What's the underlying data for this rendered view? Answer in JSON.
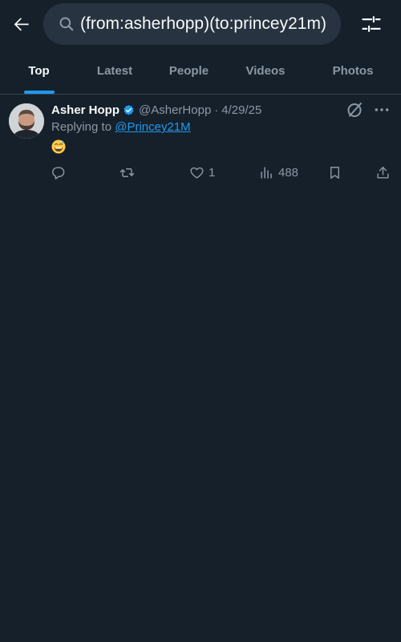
{
  "search": {
    "query": "(from:asherhopp)(to:princey21m)"
  },
  "tabs": [
    {
      "label": "Top",
      "active": true
    },
    {
      "label": "Latest",
      "active": false
    },
    {
      "label": "People",
      "active": false
    },
    {
      "label": "Videos",
      "active": false
    },
    {
      "label": "Photos",
      "active": false
    }
  ],
  "tweet": {
    "author_name": "Asher Hopp",
    "handle": "@AsherHopp",
    "separator": "·",
    "date": "4/29/25",
    "replying_prefix": "Replying to",
    "replying_to": "@Princey21M",
    "text": "😅",
    "reply_count": "",
    "retweet_count": "",
    "like_count": "1",
    "view_count": "488"
  },
  "colors": {
    "background": "#15202b",
    "accent": "#1d9bf0",
    "muted": "#8b98a5",
    "verified": "#1d9bf0"
  },
  "icons": [
    "back-arrow-icon",
    "search-icon",
    "filter-sliders-icon",
    "verified-badge-icon",
    "grok-icon",
    "more-icon",
    "reply-icon",
    "retweet-icon",
    "like-icon",
    "views-icon",
    "bookmark-icon",
    "share-icon"
  ]
}
